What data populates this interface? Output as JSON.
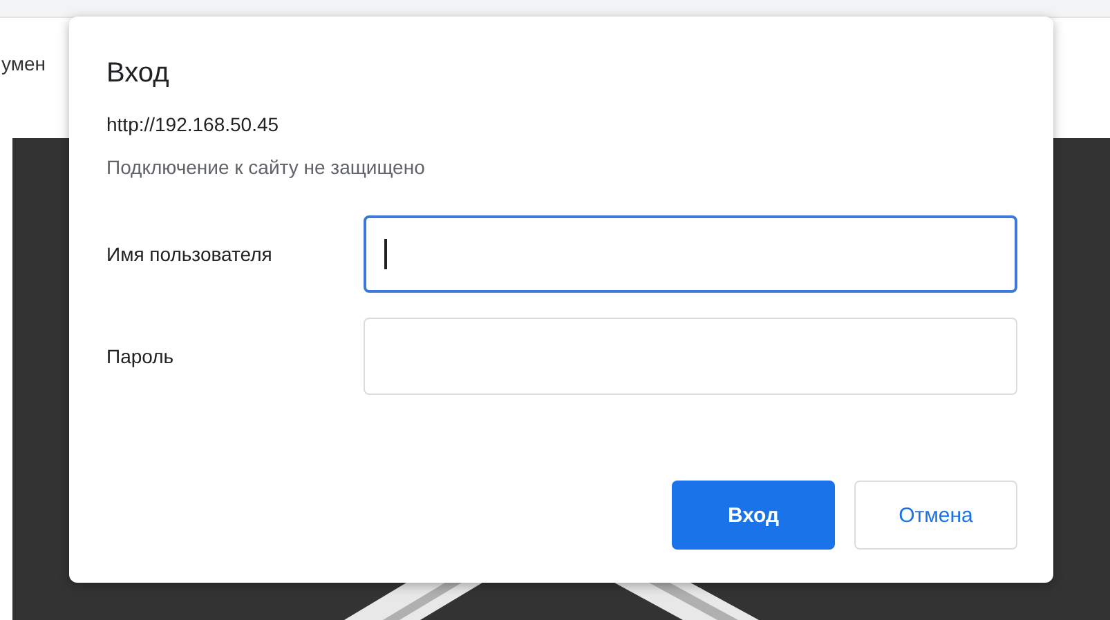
{
  "background": {
    "tab_text": "умен"
  },
  "dialog": {
    "title": "Вход",
    "url": "http://192.168.50.45",
    "notice": "Подключение к сайту не защищено",
    "fields": [
      {
        "label": "Имя пользователя",
        "focused": true
      },
      {
        "label": "Пароль",
        "focused": false
      }
    ],
    "buttons": [
      {
        "label": "Вход",
        "kind": "primary"
      },
      {
        "label": "Отмена",
        "kind": "secondary"
      }
    ]
  }
}
